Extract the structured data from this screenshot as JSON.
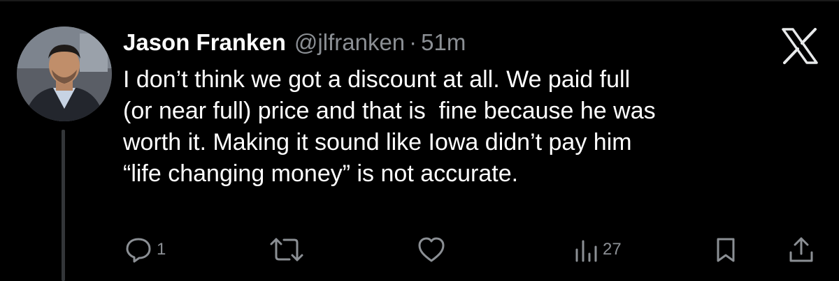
{
  "tweet": {
    "author": {
      "display_name": "Jason Franken",
      "handle": "@jlfranken",
      "time": "51m",
      "separator": "·"
    },
    "text_lines": [
      "I don’t think we got a discount at all. We paid full",
      "(or near full) price and that is  fine because he was",
      "worth it. Making it sound like Iowa didn’t pay him",
      "“life changing money” is not accurate."
    ],
    "actions": {
      "reply_count": "1",
      "repost_count": "",
      "like_count": "",
      "views_count": "27"
    }
  },
  "icons": {
    "reply": "reply-icon",
    "repost": "repost-icon",
    "like": "heart-icon",
    "views": "views-icon",
    "bookmark": "bookmark-icon",
    "share": "share-icon",
    "brand": "x-logo-icon"
  },
  "colors": {
    "background": "#000000",
    "text_primary": "#ffffff",
    "text_secondary": "#8b8f94",
    "thread_line": "#333639"
  }
}
